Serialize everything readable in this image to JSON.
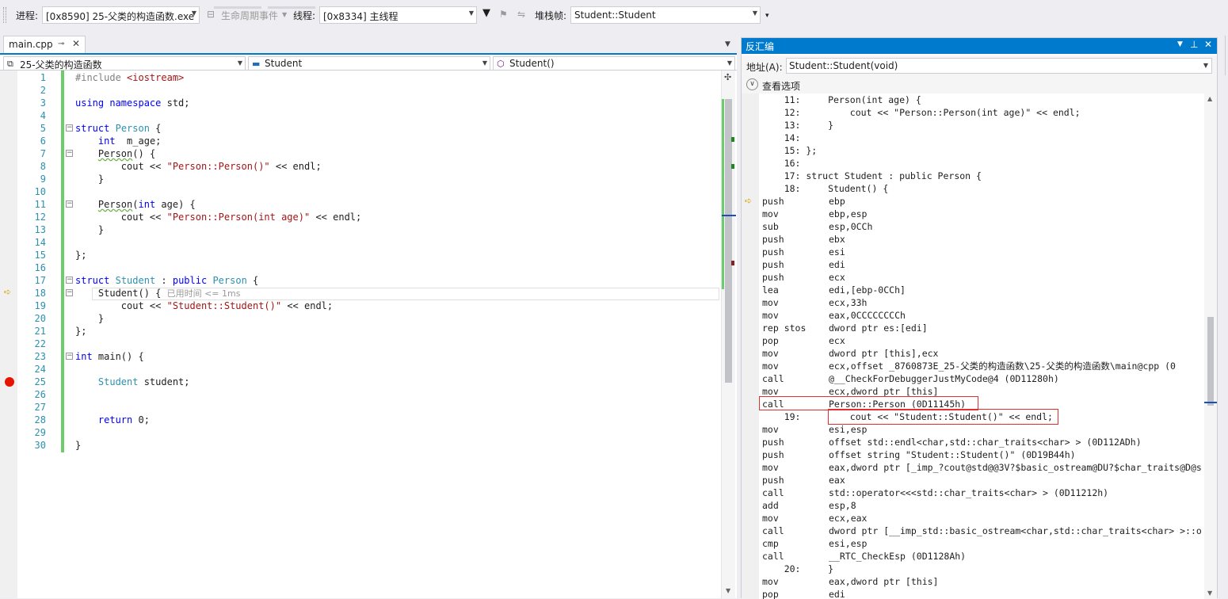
{
  "toolbar": {
    "process_label": "进程:",
    "process_value": "[0x8590] 25-父类的构造函数.exe",
    "lifecycle_label": "生命周期事件",
    "thread_label": "线程:",
    "thread_value": "[0x8334] 主线程",
    "stack_label": "堆栈帧:",
    "stack_value": "Student::Student"
  },
  "editor": {
    "tab_label": "main.cpp",
    "nav_project": "25-父类的构造函数",
    "nav_class": "Student",
    "nav_member": "Student()",
    "perf_tip": "已用时间 <= 1ms",
    "lines": [
      {
        "n": "1",
        "t": "#include <iostream>"
      },
      {
        "n": "2",
        "t": ""
      },
      {
        "n": "3",
        "t": "using namespace std;"
      },
      {
        "n": "4",
        "t": ""
      },
      {
        "n": "5",
        "t": "struct Person {"
      },
      {
        "n": "6",
        "t": "    int  m_age;"
      },
      {
        "n": "7",
        "t": "    Person() {"
      },
      {
        "n": "8",
        "t": "        cout << \"Person::Person()\" << endl;"
      },
      {
        "n": "9",
        "t": "    }"
      },
      {
        "n": "10",
        "t": ""
      },
      {
        "n": "11",
        "t": "    Person(int age) {"
      },
      {
        "n": "12",
        "t": "        cout << \"Person::Person(int age)\" << endl;"
      },
      {
        "n": "13",
        "t": "    }"
      },
      {
        "n": "14",
        "t": ""
      },
      {
        "n": "15",
        "t": "};"
      },
      {
        "n": "16",
        "t": ""
      },
      {
        "n": "17",
        "t": "struct Student : public Person {"
      },
      {
        "n": "18",
        "t": "    Student() {"
      },
      {
        "n": "19",
        "t": "        cout << \"Student::Student()\" << endl;"
      },
      {
        "n": "20",
        "t": "    }"
      },
      {
        "n": "21",
        "t": "};"
      },
      {
        "n": "22",
        "t": ""
      },
      {
        "n": "23",
        "t": "int main() {"
      },
      {
        "n": "24",
        "t": ""
      },
      {
        "n": "25",
        "t": "    Student student;"
      },
      {
        "n": "26",
        "t": ""
      },
      {
        "n": "27",
        "t": ""
      },
      {
        "n": "28",
        "t": "    return 0;"
      },
      {
        "n": "29",
        "t": ""
      },
      {
        "n": "30",
        "t": "}"
      }
    ]
  },
  "disasm": {
    "title": "反汇编",
    "address_label": "地址(A):",
    "address_value": "Student::Student(void)",
    "view_options": "查看选项",
    "lines": [
      {
        "kind": "src",
        "t": "    11:     Person(int age) {"
      },
      {
        "kind": "src",
        "t": "    12:         cout << \"Person::Person(int age)\" << endl;"
      },
      {
        "kind": "src",
        "t": "    13:     }"
      },
      {
        "kind": "src",
        "t": "    14:"
      },
      {
        "kind": "src",
        "t": "    15: };"
      },
      {
        "kind": "src",
        "t": "    16:"
      },
      {
        "kind": "src",
        "t": "    17: struct Student : public Person {"
      },
      {
        "kind": "src",
        "t": "    18:     Student() {"
      },
      {
        "kind": "asm",
        "op": "push",
        "arg": "ebp"
      },
      {
        "kind": "asm",
        "op": "mov",
        "arg": "ebp,esp"
      },
      {
        "kind": "asm",
        "op": "sub",
        "arg": "esp,0CCh"
      },
      {
        "kind": "asm",
        "op": "push",
        "arg": "ebx"
      },
      {
        "kind": "asm",
        "op": "push",
        "arg": "esi"
      },
      {
        "kind": "asm",
        "op": "push",
        "arg": "edi"
      },
      {
        "kind": "asm",
        "op": "push",
        "arg": "ecx"
      },
      {
        "kind": "asm",
        "op": "lea",
        "arg": "edi,[ebp-0CCh]"
      },
      {
        "kind": "asm",
        "op": "mov",
        "arg": "ecx,33h"
      },
      {
        "kind": "asm",
        "op": "mov",
        "arg": "eax,0CCCCCCCCh"
      },
      {
        "kind": "asm",
        "op": "rep stos",
        "arg": "dword ptr es:[edi]"
      },
      {
        "kind": "asm",
        "op": "pop",
        "arg": "ecx"
      },
      {
        "kind": "asm",
        "op": "mov",
        "arg": "dword ptr [this],ecx"
      },
      {
        "kind": "asm",
        "op": "mov",
        "arg": "ecx,offset _8760873E_25-父类的构造函数\\25-父类的构造函数\\main@cpp (0"
      },
      {
        "kind": "asm",
        "op": "call",
        "arg": "@__CheckForDebuggerJustMyCode@4 (0D11280h)"
      },
      {
        "kind": "asm",
        "op": "mov",
        "arg": "ecx,dword ptr [this]"
      },
      {
        "kind": "asm",
        "op": "call",
        "arg": "Person::Person (0D11145h)"
      },
      {
        "kind": "src",
        "t": "    19:         cout << \"Student::Student()\" << endl;"
      },
      {
        "kind": "asm",
        "op": "mov",
        "arg": "esi,esp"
      },
      {
        "kind": "asm",
        "op": "push",
        "arg": "offset std::endl<char,std::char_traits<char> > (0D112ADh)"
      },
      {
        "kind": "asm",
        "op": "push",
        "arg": "offset string \"Student::Student()\" (0D19B44h)"
      },
      {
        "kind": "asm",
        "op": "mov",
        "arg": "eax,dword ptr [_imp_?cout@std@@3V?$basic_ostream@DU?$char_traits@D@s"
      },
      {
        "kind": "asm",
        "op": "push",
        "arg": "eax"
      },
      {
        "kind": "asm",
        "op": "call",
        "arg": "std::operator<<<std::char_traits<char> > (0D11212h)"
      },
      {
        "kind": "asm",
        "op": "add",
        "arg": "esp,8"
      },
      {
        "kind": "asm",
        "op": "mov",
        "arg": "ecx,eax"
      },
      {
        "kind": "asm",
        "op": "call",
        "arg": "dword ptr [__imp_std::basic_ostream<char,std::char_traits<char> >::o"
      },
      {
        "kind": "asm",
        "op": "cmp",
        "arg": "esi,esp"
      },
      {
        "kind": "asm",
        "op": "call",
        "arg": "__RTC_CheckEsp (0D1128Ah)"
      },
      {
        "kind": "src",
        "t": "    20:     }"
      },
      {
        "kind": "asm",
        "op": "mov",
        "arg": "eax,dword ptr [this]"
      },
      {
        "kind": "asm",
        "op": "pop",
        "arg": "edi"
      }
    ]
  }
}
